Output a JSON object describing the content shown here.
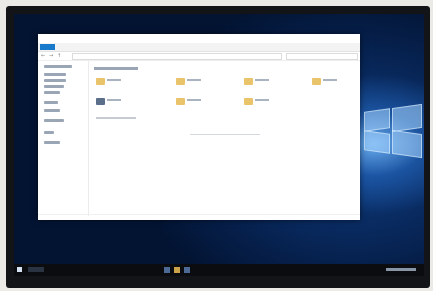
{
  "explorer": {
    "ribbon_tabs": [
      "",
      "",
      "",
      ""
    ],
    "quick_access_heading": "",
    "folders": [
      "",
      "",
      "",
      "",
      "",
      "",
      ""
    ]
  },
  "colors": {
    "accent": "#1979ca",
    "folder": "#e9c46a",
    "desktop": "#0b2a5c",
    "taskbar": "#0a0c10"
  },
  "icons": {
    "start": "windows-logo-icon",
    "search": "search-icon",
    "folder": "folder-icon"
  }
}
